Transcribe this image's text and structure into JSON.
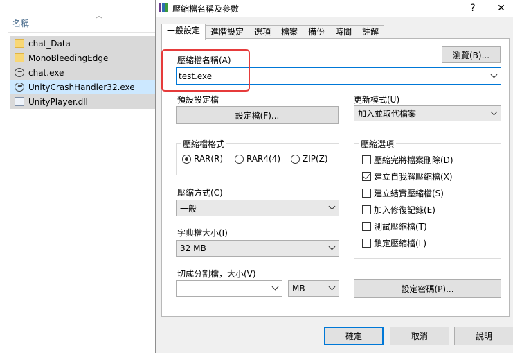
{
  "explorer": {
    "column_header": "名稱",
    "files": [
      {
        "name": "chat_Data",
        "icon": "folder-icon",
        "selected": false
      },
      {
        "name": "MonoBleedingEdge",
        "icon": "folder-icon",
        "selected": false
      },
      {
        "name": "chat.exe",
        "icon": "unity-exe-icon",
        "selected": false
      },
      {
        "name": "UnityCrashHandler32.exe",
        "icon": "unity-exe-icon",
        "selected": true
      },
      {
        "name": "UnityPlayer.dll",
        "icon": "dll-file-icon",
        "selected": false
      }
    ]
  },
  "dialog": {
    "title": "壓縮檔名稱及參數",
    "help_glyph": "?",
    "close_glyph": "✕",
    "tabs": [
      "一般設定",
      "進階設定",
      "選項",
      "檔案",
      "備份",
      "時間",
      "註解"
    ],
    "active_tab": 0,
    "archive_name_label": "壓縮檔名稱(A)",
    "archive_name_value": "test.exe",
    "browse_button": "瀏覽(B)...",
    "profile_label": "預設設定檔",
    "profile_button": "設定檔(F)...",
    "update_mode_label": "更新模式(U)",
    "update_mode_value": "加入並取代檔案",
    "format_group": "壓縮檔格式",
    "formats": [
      {
        "label": "RAR(R)",
        "checked": true
      },
      {
        "label": "RAR4(4)",
        "checked": false
      },
      {
        "label": "ZIP(Z)",
        "checked": false
      }
    ],
    "method_label": "壓縮方式(C)",
    "method_value": "一般",
    "dict_label": "字典檔大小(I)",
    "dict_value": "32 MB",
    "split_label": "切成分割檔，大小(V)",
    "split_value": "",
    "split_unit": "MB",
    "options_group": "壓縮選項",
    "options": [
      {
        "label": "壓縮完將檔案刪除(D)",
        "checked": false
      },
      {
        "label": "建立自我解壓縮檔(X)",
        "checked": true
      },
      {
        "label": "建立結實壓縮檔(S)",
        "checked": false
      },
      {
        "label": "加入修復記錄(E)",
        "checked": false
      },
      {
        "label": "測試壓縮檔(T)",
        "checked": false
      },
      {
        "label": "鎖定壓縮檔(L)",
        "checked": false
      }
    ],
    "password_button": "設定密碼(P)...",
    "ok_button": "確定",
    "cancel_button": "取消",
    "help_button": "說明"
  },
  "colors": {
    "highlight_border": "#e63b3b",
    "focus_blue": "#0078d7",
    "selected_row": "#cce8ff"
  }
}
